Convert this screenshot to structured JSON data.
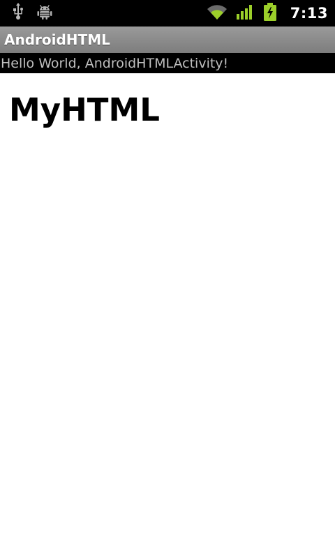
{
  "status_bar": {
    "time": "7:13",
    "icons": [
      "usb-icon",
      "debug-android-icon",
      "wifi-icon",
      "signal-icon",
      "battery-charging-icon"
    ],
    "accent_color": "#9ccf2a"
  },
  "app": {
    "title": "AndroidHTML"
  },
  "activity": {
    "hello_text": "Hello World, AndroidHTMLActivity!"
  },
  "webview": {
    "heading": "MyHTML"
  }
}
